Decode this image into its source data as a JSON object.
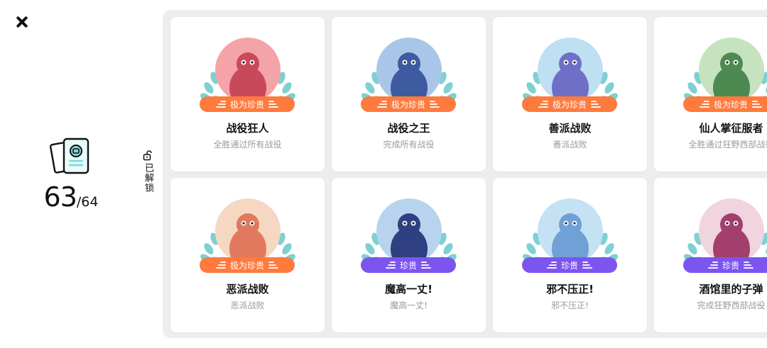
{
  "stats": {
    "unlocked": "63",
    "total": "/64"
  },
  "unlock_label": "已解锁",
  "cards": [
    {
      "title": "战役狂人",
      "desc": "全胜通过所有战役",
      "rarity": "极为珍贵",
      "rarity_color": "#ff7a3d",
      "bg": "#f4a3a8",
      "figure": "#c84a5a"
    },
    {
      "title": "战役之王",
      "desc": "完成所有战役",
      "rarity": "极为珍贵",
      "rarity_color": "#ff7a3d",
      "bg": "#a9c6e8",
      "figure": "#3e5aa0"
    },
    {
      "title": "善派战败",
      "desc": "善派战败",
      "rarity": "极为珍贵",
      "rarity_color": "#ff7a3d",
      "bg": "#bfdff2",
      "figure": "#6e6fc7"
    },
    {
      "title": "仙人掌征服者",
      "desc": "全胜通过狂野西部战役",
      "rarity": "极为珍贵",
      "rarity_color": "#ff7a3d",
      "bg": "#c6e3c0",
      "figure": "#4c8a52"
    },
    {
      "title": "恶派战败",
      "desc": "恶派战败",
      "rarity": "极为珍贵",
      "rarity_color": "#ff7a3d",
      "bg": "#f6d7c2",
      "figure": "#e2785d"
    },
    {
      "title": "魔高一丈!",
      "desc": "魔高一丈!",
      "rarity": "珍贵",
      "rarity_color": "#7c55ef",
      "bg": "#b7d3ee",
      "figure": "#2e3f82"
    },
    {
      "title": "邪不压正!",
      "desc": "邪不压正!",
      "rarity": "珍贵",
      "rarity_color": "#7c55ef",
      "bg": "#c4e2f3",
      "figure": "#6fa0d6"
    },
    {
      "title": "酒馆里的子弹",
      "desc": "完成狂野西部战役",
      "rarity": "珍贵",
      "rarity_color": "#7c55ef",
      "bg": "#f0d4de",
      "figure": "#a23f6d"
    }
  ]
}
